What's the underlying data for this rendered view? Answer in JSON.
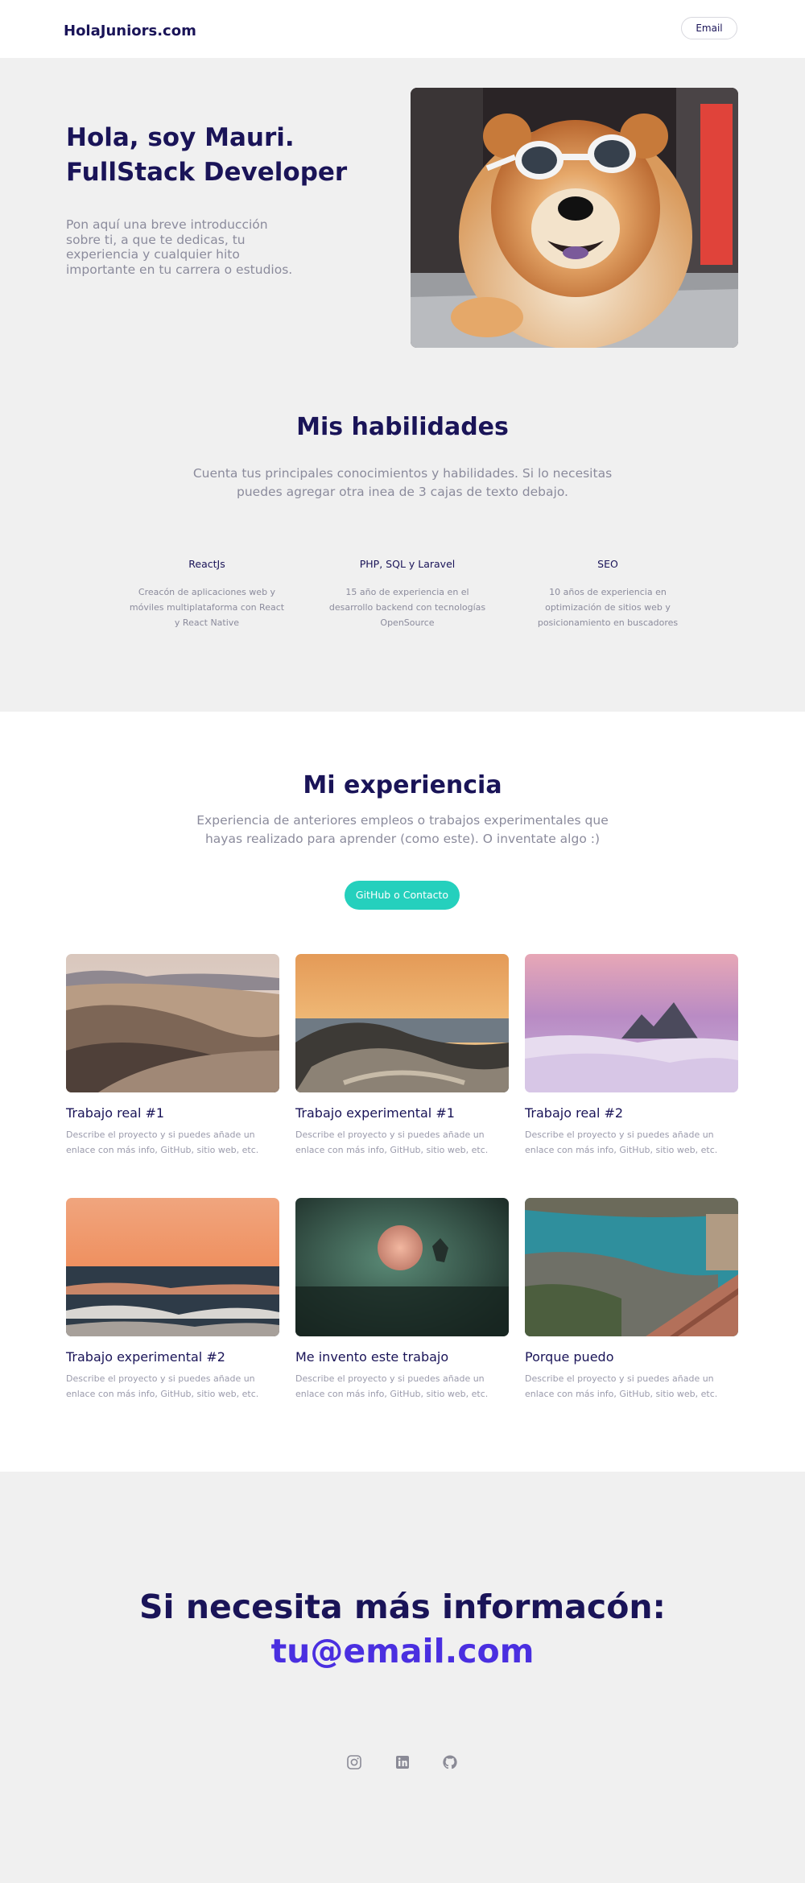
{
  "header": {
    "logo": "HolaJuniors.com",
    "email_button": "Email"
  },
  "hero": {
    "title_line1": "Hola, soy Mauri.",
    "title_line2": "FullStack Developer",
    "intro": "Pon aquí una breve introducción sobre ti, a que te dedicas, tu experiencia y cualquier hito importante en tu carrera o estudios.",
    "image": "dog-with-sunglasses-photo"
  },
  "skills": {
    "title": "Mis habilidades",
    "subtitle": "Cuenta tus principales conocimientos y habilidades. Si lo necesitas puedes agregar otra inea de 3 cajas de texto debajo.",
    "items": [
      {
        "title": "ReactJs",
        "desc": "Creacón de aplicaciones web y móviles multiplataforma con React y React Native"
      },
      {
        "title": "PHP, SQL y Laravel",
        "desc": "15 año de experiencia en el desarrollo backend con tecnologías OpenSource"
      },
      {
        "title": "SEO",
        "desc": "10 años de experiencia en optimización de sitios web y posicionamiento en buscadores"
      }
    ]
  },
  "experience": {
    "title": "Mi experiencia",
    "subtitle": "Experiencia de anteriores empleos o trabajos experimentales que hayas realizado para aprender (como este). O inventate algo :)",
    "cta": "GitHub o Contacto",
    "projects": [
      {
        "title": "Trabajo real #1",
        "desc": "Describe el proyecto y si puedes añade un enlace con más info, GitHub, sitio web, etc.",
        "image": "desert-dunes"
      },
      {
        "title": "Trabajo experimental #1",
        "desc": "Describe el proyecto y si puedes añade un enlace con más info, GitHub, sitio web, etc.",
        "image": "coastal-rocks-sunset"
      },
      {
        "title": "Trabajo real #2",
        "desc": "Describe el proyecto y si puedes añade un enlace con más info, GitHub, sitio web, etc.",
        "image": "mountain-peaks-above-clouds"
      },
      {
        "title": "Trabajo experimental #2",
        "desc": "Describe el proyecto y si puedes añade un enlace con más info, GitHub, sitio web, etc.",
        "image": "ocean-waves-sunset"
      },
      {
        "title": "Me invento este trabajo",
        "desc": "Describe el proyecto y si puedes añade un enlace con más info, GitHub, sitio web, etc.",
        "image": "misty-green-moon"
      },
      {
        "title": "Porque puedo",
        "desc": "Describe el proyecto y si puedes añade un enlace con más info, GitHub, sitio web, etc.",
        "image": "mediterranean-cove-rooftops"
      }
    ]
  },
  "contact": {
    "title": "Si necesita más informacón:",
    "email": "tu@email.com",
    "social_icons": [
      "instagram-icon",
      "linkedin-icon",
      "github-icon"
    ]
  },
  "colors": {
    "primary_text": "#1a1458",
    "muted_text": "#8b8b9c",
    "accent": "#25d0bd",
    "email_accent": "#4a2fe0",
    "section_bg": "#f0f0f0"
  }
}
